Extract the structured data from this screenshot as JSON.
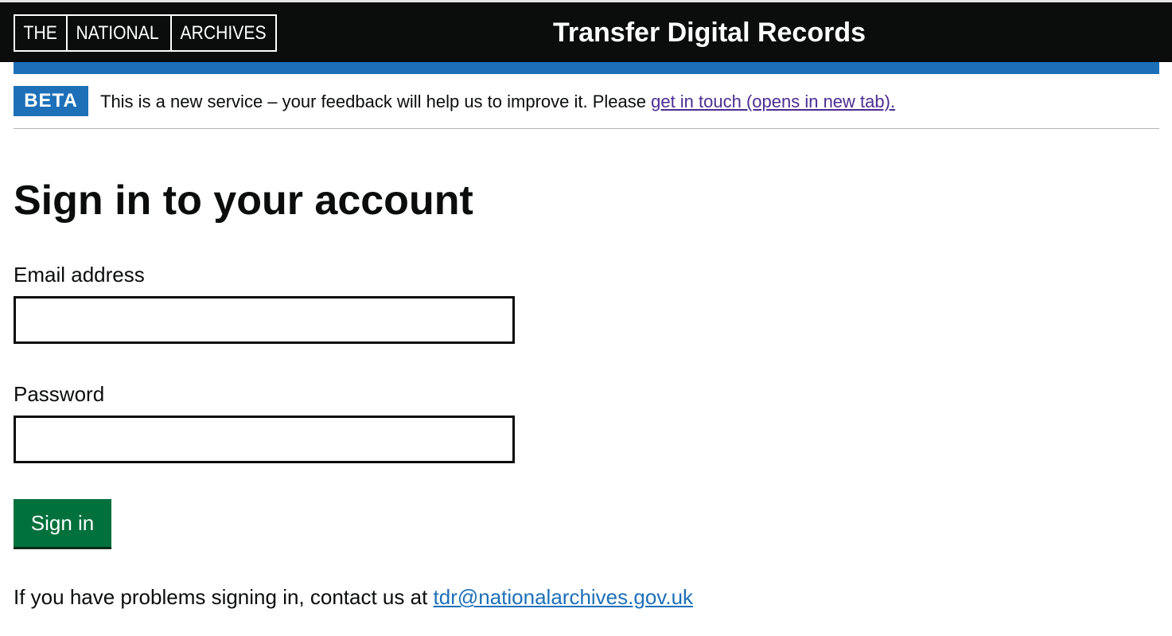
{
  "header": {
    "logo": [
      "THE",
      "NATIONAL",
      "ARCHIVES"
    ],
    "service_name": "Transfer Digital Records"
  },
  "phase_banner": {
    "tag": "BETA",
    "text": "This is a new service – your feedback will help us to improve it. Please ",
    "link": "get in touch (opens in new tab)."
  },
  "main": {
    "title": "Sign in to your account",
    "email_label": "Email address",
    "email_value": "",
    "password_label": "Password",
    "password_value": "",
    "signin_label": "Sign in",
    "help_text": "If you have problems signing in, contact us at ",
    "help_link": "tdr@nationalarchives.gov.uk"
  },
  "colors": {
    "header_bg": "#0b0c0c",
    "accent_blue": "#1d70b8",
    "button_green": "#00703c",
    "visited_link": "#4c2c92"
  }
}
